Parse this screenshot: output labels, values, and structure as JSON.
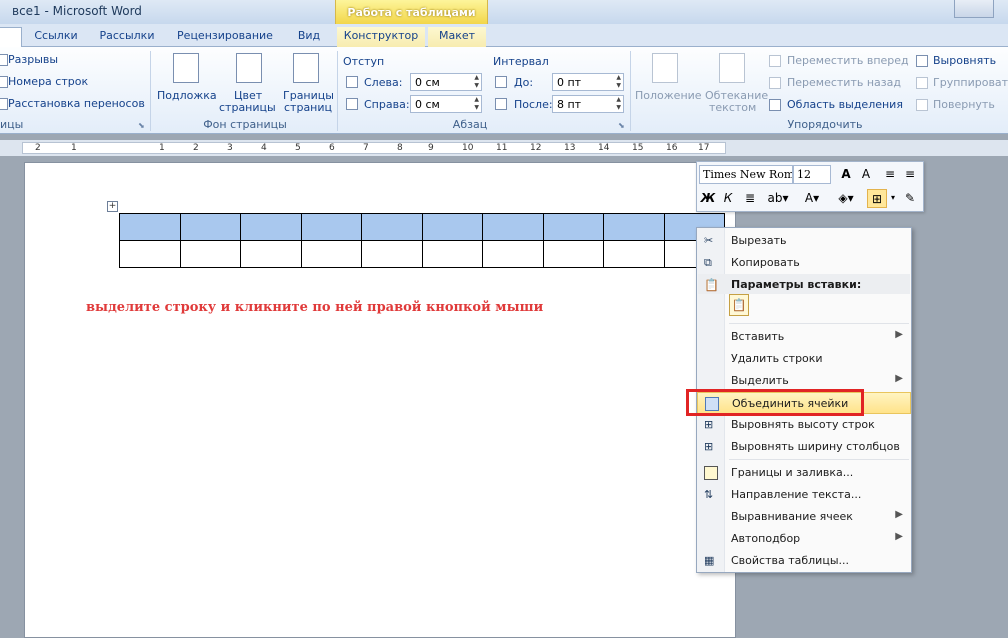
{
  "window": {
    "title": "все1  -  Microsoft Word",
    "context_tab_header": "Работа с таблицами"
  },
  "tabs": [
    "Ссылки",
    "Рассылки",
    "Рецензирование",
    "Вид",
    "Конструктор",
    "Макет"
  ],
  "ribbon": {
    "page_setup": {
      "breaks": "Разрывы",
      "line_numbers": "Номера строк",
      "hyphenation": "Расстановка переносов",
      "group_tail": "ицы"
    },
    "page_background": {
      "watermark": "Подложка",
      "page_color_1": "Цвет",
      "page_color_2": "страницы",
      "page_borders_1": "Границы",
      "page_borders_2": "страниц",
      "label": "Фон страницы"
    },
    "paragraph": {
      "indent_label": "Отступ",
      "left_label": "Слева:",
      "left_value": "0 см",
      "right_label": "Справа:",
      "right_value": "0 см",
      "spacing_label": "Интервал",
      "before_label": "До:",
      "before_value": "0 пт",
      "after_label": "После:",
      "after_value": "8 пт",
      "label": "Абзац"
    },
    "arrange": {
      "position_1": "Положение",
      "wrap_1": "Обтекание",
      "wrap_2": "текстом",
      "bring_forward": "Переместить вперед",
      "send_backward": "Переместить назад",
      "selection_pane": "Область выделения",
      "align": "Выровнять",
      "group": "Группировать",
      "rotate": "Повернуть",
      "label": "Упорядочить"
    }
  },
  "ruler": {
    "numbers": [
      "2",
      "1",
      "1",
      "2",
      "3",
      "4",
      "5",
      "6",
      "7",
      "8",
      "9",
      "10",
      "11",
      "12",
      "13",
      "14",
      "15",
      "16",
      "17"
    ]
  },
  "document": {
    "table": {
      "rows": 2,
      "cols": 10,
      "selected_row": 1
    },
    "instruction": "выделите строку и кликните по ней правой кнопкой мыши"
  },
  "mini_toolbar": {
    "font": "Times New Rom",
    "size": "12",
    "bold": "Ж",
    "italic": "К"
  },
  "context_menu": {
    "cut": "Вырезать",
    "copy": "Копировать",
    "paste_options": "Параметры вставки:",
    "insert": "Вставить",
    "delete_rows": "Удалить строки",
    "select": "Выделить",
    "merge_cells": "Объединить ячейки",
    "distribute_rows": "Выровнять высоту строк",
    "distribute_cols": "Выровнять ширину столбцов",
    "borders_shading": "Границы и заливка...",
    "text_direction": "Направление текста...",
    "cell_alignment": "Выравнивание ячеек",
    "autofit": "Автоподбор",
    "table_properties": "Свойства таблицы..."
  },
  "colors": {
    "highlight_border": "#e12424",
    "selected_row": "#a9c8ee",
    "instruction_text": "#e03a3a"
  }
}
